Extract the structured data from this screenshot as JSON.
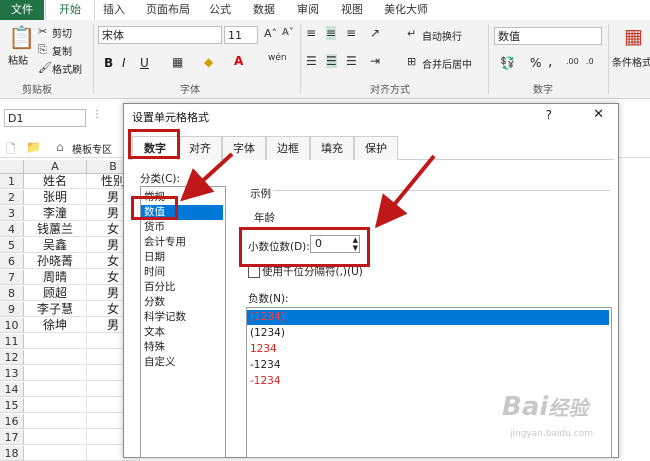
{
  "ribbon_tabs": [
    "文件",
    "开始",
    "插入",
    "页面布局",
    "公式",
    "数据",
    "审阅",
    "视图",
    "美化大师"
  ],
  "clipboard": {
    "paste": "粘贴",
    "cut": "剪切",
    "copy": "复制",
    "format_painter": "格式刷",
    "group": "剪贴板"
  },
  "font": {
    "name": "宋体",
    "size": "11",
    "bold": "B",
    "italic": "I",
    "underline": "U",
    "group": "字体"
  },
  "alignment": {
    "wrap": "自动换行",
    "merge": "合并后居中",
    "group": "对齐方式"
  },
  "number": {
    "format": "数值",
    "percent": "%",
    "comma": ",",
    "group": "数字"
  },
  "styles": {
    "conditional": "条件格式"
  },
  "name_box": "D1",
  "sheet_tab": "模板专区",
  "columns": [
    "A",
    "B"
  ],
  "rows": [
    {
      "num": "1",
      "name": "姓名",
      "gender": "性别"
    },
    {
      "num": "2",
      "name": "张明",
      "gender": "男"
    },
    {
      "num": "3",
      "name": "李潼",
      "gender": "男"
    },
    {
      "num": "4",
      "name": "钱蕙兰",
      "gender": "女"
    },
    {
      "num": "5",
      "name": "吴鑫",
      "gender": "男"
    },
    {
      "num": "6",
      "name": "孙晓菁",
      "gender": "女"
    },
    {
      "num": "7",
      "name": "周晴",
      "gender": "女"
    },
    {
      "num": "8",
      "name": "顾超",
      "gender": "男"
    },
    {
      "num": "9",
      "name": "李子慧",
      "gender": "女"
    },
    {
      "num": "10",
      "name": "徐坤",
      "gender": "男"
    },
    {
      "num": "11",
      "name": "",
      "gender": ""
    },
    {
      "num": "12",
      "name": "",
      "gender": ""
    },
    {
      "num": "13",
      "name": "",
      "gender": ""
    },
    {
      "num": "14",
      "name": "",
      "gender": ""
    },
    {
      "num": "15",
      "name": "",
      "gender": ""
    },
    {
      "num": "16",
      "name": "",
      "gender": ""
    },
    {
      "num": "17",
      "name": "",
      "gender": ""
    },
    {
      "num": "18",
      "name": "",
      "gender": ""
    }
  ],
  "dialog": {
    "title": "设置单元格格式",
    "help": "?",
    "close": "✕",
    "tabs": [
      "数字",
      "对齐",
      "字体",
      "边框",
      "填充",
      "保护"
    ],
    "category_label": "分类(C):",
    "categories": [
      "常规",
      "数值",
      "货币",
      "会计专用",
      "日期",
      "时间",
      "百分比",
      "分数",
      "科学记数",
      "文本",
      "特殊",
      "自定义"
    ],
    "selected_category": "数值",
    "sample_label": "示例",
    "sample_value": "年龄",
    "decimal_label": "小数位数(D):",
    "decimal_value": "0",
    "thousands_label": "使用千位分隔符(,)(U)",
    "negative_label": "负数(N):",
    "negatives": [
      {
        "text": "(1234)",
        "color": "#ff3b3b",
        "selected": true
      },
      {
        "text": "(1234)",
        "color": "#222222",
        "selected": false
      },
      {
        "text": "1234",
        "color": "#e02020",
        "selected": false
      },
      {
        "text": "-1234",
        "color": "#222222",
        "selected": false
      },
      {
        "text": "-1234",
        "color": "#e02020",
        "selected": false
      }
    ]
  },
  "watermark": {
    "brand": "Bai",
    "brand2": "经验",
    "url": "jingyan.baidu.com"
  },
  "colors": {
    "excel_green": "#217346",
    "select_blue": "#0078d7",
    "annotation_red": "#c01818"
  }
}
